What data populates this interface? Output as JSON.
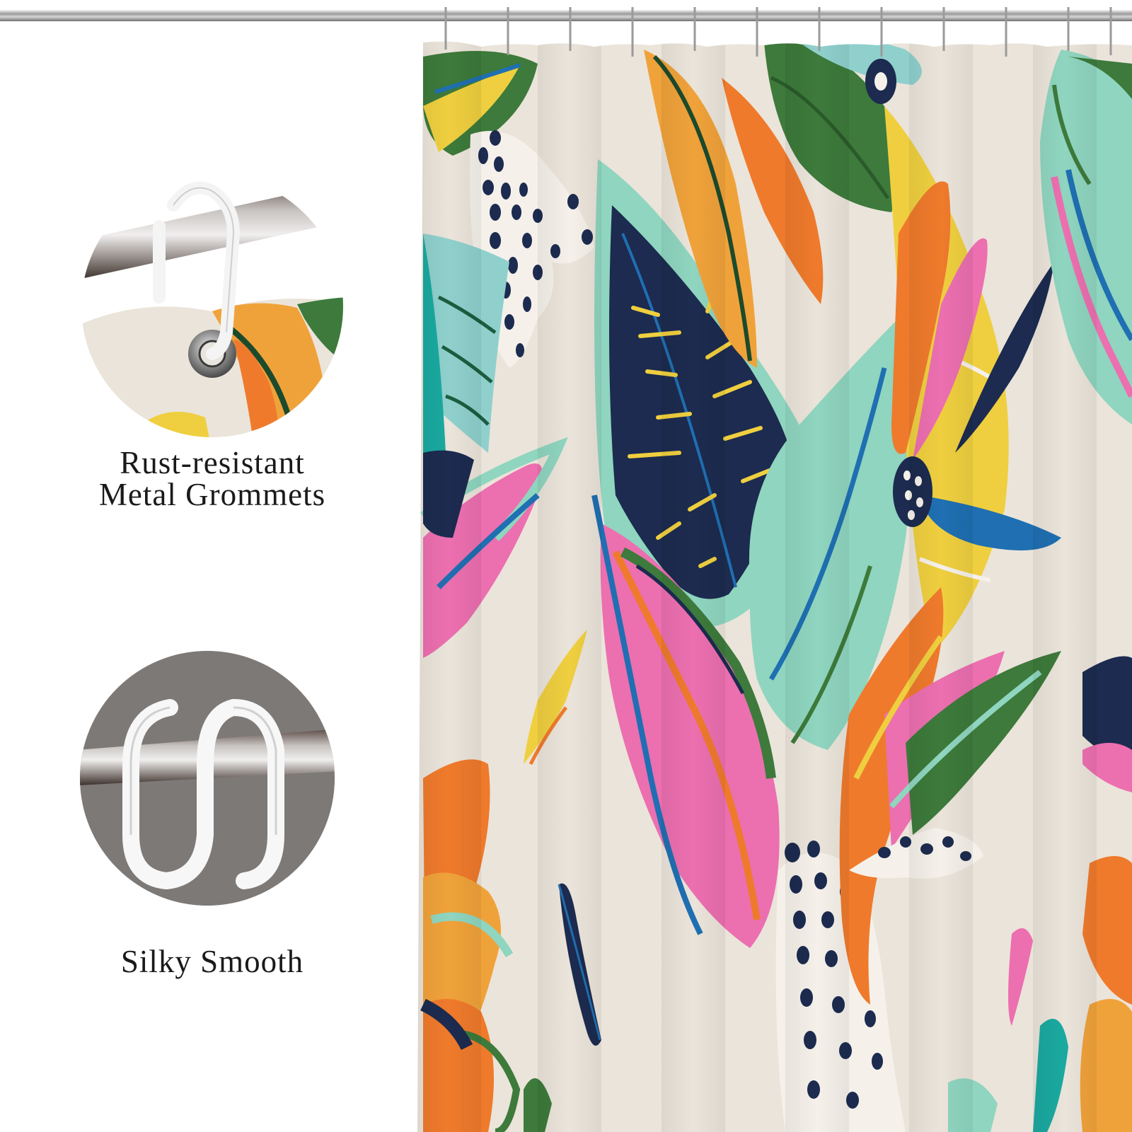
{
  "captions": {
    "grommets_line1": "Rust-resistant",
    "grommets_line2": "Metal Grommets",
    "silky": "Silky Smooth"
  },
  "colors": {
    "background": "#ffffff",
    "curtain_base": "#ebe4da",
    "navy": "#1c2b4f",
    "pink": "#ec6fb0",
    "orange": "#ef7a2c",
    "yellow": "#efcf3f",
    "green": "#3d7a3b",
    "mint": "#8fd5bf",
    "teal": "#1aa9a0",
    "blue": "#1f6fb2"
  },
  "icons": {
    "rod": "metal-rod",
    "ring": "c-ring-hook",
    "grommet": "metal-grommet"
  }
}
